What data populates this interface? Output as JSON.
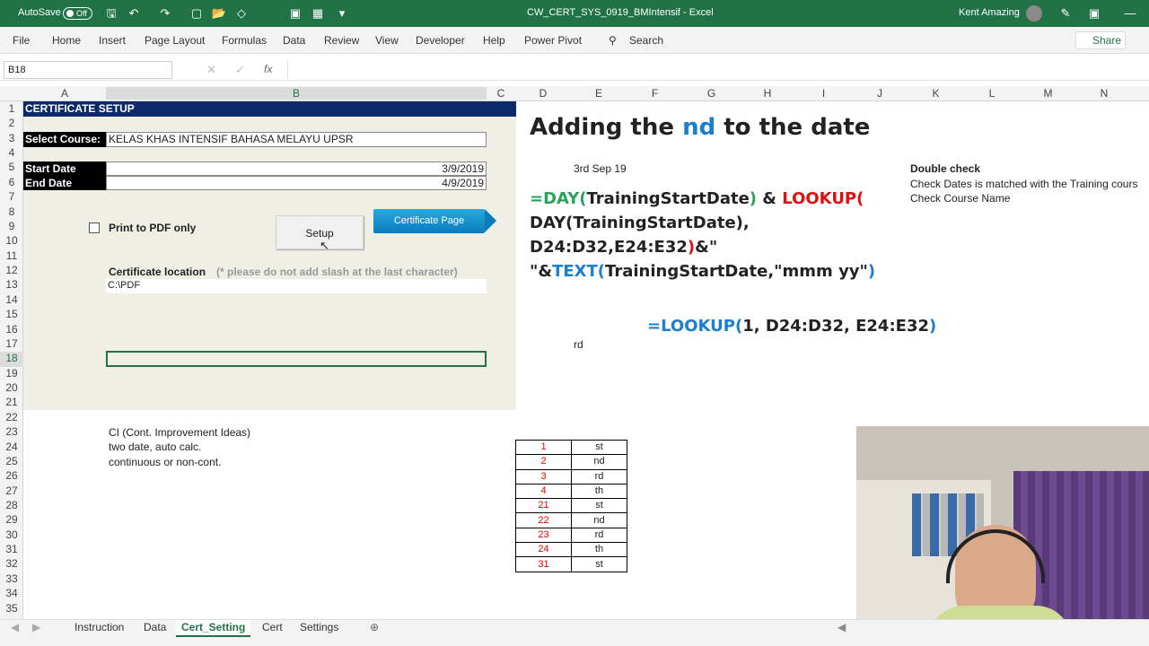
{
  "titlebar": {
    "autosave_label": "AutoSave",
    "autosave_state": "Off",
    "doc_title": "CW_CERT_SYS_0919_BMIntensif - Excel",
    "user_name": "Kent Amazing"
  },
  "ribbon": {
    "tabs": [
      "File",
      "Home",
      "Insert",
      "Page Layout",
      "Formulas",
      "Data",
      "Review",
      "View",
      "Developer",
      "Help",
      "Power Pivot"
    ],
    "search_label": "Search",
    "share_label": "Share"
  },
  "formula_bar": {
    "name_box": "B18",
    "fx": "fx"
  },
  "columns": [
    "A",
    "B",
    "C",
    "D",
    "E",
    "F",
    "G",
    "H",
    "I",
    "J",
    "K",
    "L",
    "M",
    "N"
  ],
  "rows": [
    "1",
    "2",
    "3",
    "4",
    "5",
    "6",
    "7",
    "8",
    "9",
    "10",
    "11",
    "12",
    "13",
    "14",
    "15",
    "16",
    "17",
    "18",
    "19",
    "20",
    "21",
    "22",
    "23",
    "24",
    "25",
    "26",
    "27",
    "28",
    "29",
    "30",
    "31",
    "32",
    "33",
    "34",
    "35"
  ],
  "panel": {
    "header": "CERTIFICATE SETUP",
    "select_course_label": "Select Course:",
    "select_course_value": "KELAS KHAS INTENSIF BAHASA MELAYU UPSR",
    "start_date_label": "Start Date",
    "start_date_value": "3/9/2019",
    "end_date_label": "End Date",
    "end_date_value": "4/9/2019",
    "print_pdf_label": "Print to PDF only",
    "setup_button": "Setup",
    "cert_page_button": "Certificate Page",
    "cert_location_label": "Certificate location",
    "cert_location_note": "(* please do not add slash at the last character)",
    "cert_location_value": "C:\\PDF"
  },
  "notes": {
    "heading": "Adding the ",
    "heading_highlight": "nd",
    "heading_tail": " to the date",
    "sample_date": "3rd Sep 19",
    "double_check_title": "Double check",
    "double_check_line1": "Check Dates is matched with the Training cours",
    "double_check_line2": "Check Course Name",
    "rd_cell": "rd",
    "ci_line1": "CI (Cont. Improvement Ideas)",
    "ci_line2": "two date, auto calc.",
    "ci_line3": "continuous or non-cont."
  },
  "formula1": {
    "p1": "=DAY(",
    "p2": "TrainingStartDate",
    "p3": ")",
    "p4": " & ",
    "p5": "LOOKUP(",
    "line2": "DAY(TrainingStartDate),",
    "line3a": "D24:D32,E24:E32",
    "line3b": ")",
    "line3c": "&\"",
    "line4a": "\"&",
    "line4b": "TEXT(",
    "line4c": "TrainingStartDate,\"mmm yy\"",
    "line4d": ")"
  },
  "formula2": {
    "p1": "=LOOKUP(",
    "p2": "1, D24:D32, E24:E32",
    "p3": ")"
  },
  "lookup_table": [
    [
      "1",
      "st"
    ],
    [
      "2",
      "nd"
    ],
    [
      "3",
      "rd"
    ],
    [
      "4",
      "th"
    ],
    [
      "21",
      "st"
    ],
    [
      "22",
      "nd"
    ],
    [
      "23",
      "rd"
    ],
    [
      "24",
      "th"
    ],
    [
      "31",
      "st"
    ]
  ],
  "sheets": [
    "Instruction",
    "Data",
    "Cert_Setting",
    "Cert",
    "Settings"
  ],
  "active_sheet": "Cert_Setting",
  "colors": {
    "excel_green": "#217346",
    "header_navy": "#0a2a6b",
    "formula_green": "#2aa35a",
    "formula_red": "#e01010",
    "formula_blue": "#1a7fd0"
  }
}
